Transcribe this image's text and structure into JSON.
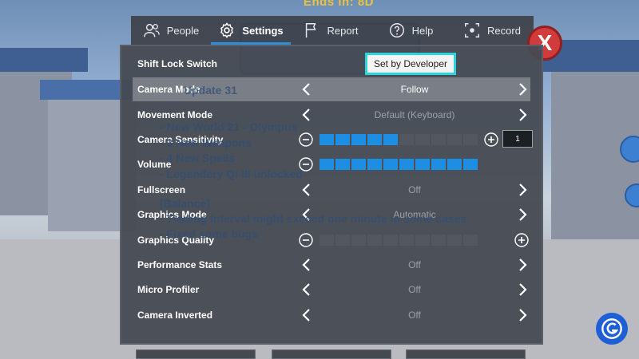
{
  "event_banner": "Ends in: 8D",
  "tabs": [
    {
      "label": "People",
      "icon": "people-icon",
      "active": false
    },
    {
      "label": "Settings",
      "icon": "gear-icon",
      "active": true
    },
    {
      "label": "Report",
      "icon": "flag-icon",
      "active": false
    },
    {
      "label": "Help",
      "icon": "help-icon",
      "active": false
    },
    {
      "label": "Record",
      "icon": "record-icon",
      "active": false
    }
  ],
  "close_glyph": "X",
  "settings": {
    "shift_lock": {
      "label": "Shift Lock Switch",
      "value": "Set by Developer"
    },
    "camera_mode": {
      "label": "Camera Mode",
      "value": "Follow"
    },
    "movement_mode": {
      "label": "Movement Mode",
      "value": "Default (Keyboard)"
    },
    "camera_sensitivity": {
      "label": "Camera Sensitivity",
      "level": 5,
      "max": 10,
      "input_value": "1"
    },
    "volume": {
      "label": "Volume",
      "level": 10,
      "max": 10
    },
    "fullscreen": {
      "label": "Fullscreen",
      "value": "Off"
    },
    "graphics_mode": {
      "label": "Graphics Mode",
      "value": "Automatic"
    },
    "graphics_quality": {
      "label": "Graphics Quality",
      "level": 0,
      "max": 10
    },
    "performance_stats": {
      "label": "Performance Stats",
      "value": "Off"
    },
    "micro_profiler": {
      "label": "Micro Profiler",
      "value": "Off"
    },
    "camera_inverted": {
      "label": "Camera Inverted",
      "value": "Off"
    }
  },
  "update_notes": [
    "Update 31",
    "- New World 21 - Olympus",
    "- 3 New Weapons",
    "- 4 New Spells",
    "- Legendery Qi III unlocked",
    "[Balance]",
    "- Trading interval might exceed one minute in some cases",
    "- Fixed some bugs"
  ],
  "colors": {
    "accent": "#1e8ee3",
    "highlight_border": "#2ad6de",
    "close": "#d13b3b"
  }
}
